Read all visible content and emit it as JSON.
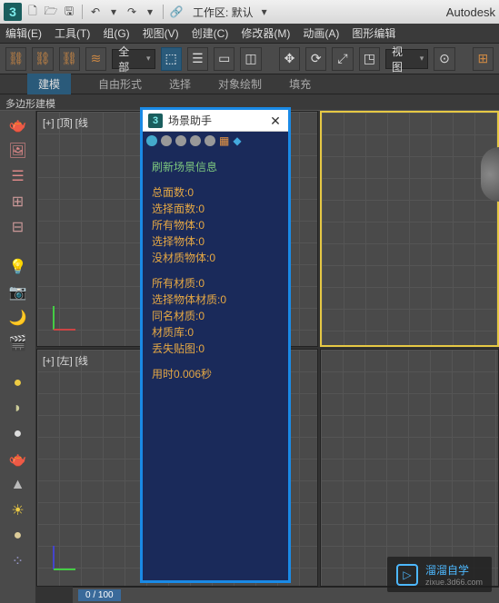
{
  "title_bar": {
    "workspace_label": "工作区: 默认",
    "app_name": "Autodesk"
  },
  "menus": {
    "edit": "编辑(E)",
    "tools": "工具(T)",
    "group": "组(G)",
    "views": "视图(V)",
    "create": "创建(C)",
    "modifiers": "修改器(M)",
    "animation": "动画(A)",
    "graph": "图形编辑"
  },
  "toolbar": {
    "filter_dropdown": "全部",
    "view_dropdown": "视图"
  },
  "sub_tabs": {
    "modeling": "建模",
    "freeform": "自由形式",
    "selection": "选择",
    "object_paint": "对象绘制",
    "populate": "填充"
  },
  "ribbon_label": "多边形建模",
  "viewports": {
    "top": "[+] [顶] [线",
    "left": "[+] [左] [线"
  },
  "dialog": {
    "title": "场景助手",
    "refresh_label": "刷新场景信息",
    "total_faces": "总面数:0",
    "selected_faces": "选择面数:0",
    "all_objects": "所有物体:0",
    "selected_objects": "选择物体:0",
    "no_material_objects": "没材质物体:0",
    "all_materials": "所有材质:0",
    "selected_obj_materials": "选择物体材质:0",
    "same_name_materials": "同名材质:0",
    "material_library": "材质库:0",
    "missing_maps": "丢失贴图:0",
    "elapsed": "用时0.006秒"
  },
  "timeline": {
    "current": "0 / 100"
  },
  "watermark": {
    "text": "溜溜自学",
    "url": "zixue.3d66.com"
  }
}
